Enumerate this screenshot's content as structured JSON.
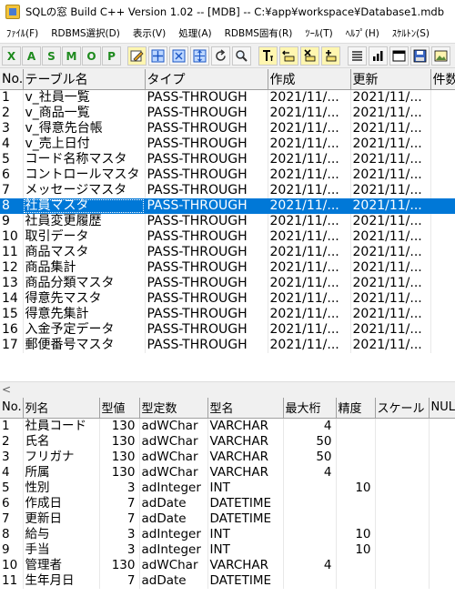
{
  "window": {
    "title": "SQLの窓 Build C++ Version 1.02 -- [MDB] -- C:¥app¥workspace¥Database1.mdb"
  },
  "menu": [
    "ﾌｧｲﾙ(F)",
    "RDBMS選択(D)",
    "表示(V)",
    "処理(A)",
    "RDBMS固有(R)",
    "ﾂｰﾙ(T)",
    "ﾍﾙﾌﾟ(H)",
    "ｽｹﾙﾄﾝ(S)"
  ],
  "toolbar": {
    "letters": [
      "X",
      "A",
      "S",
      "M",
      "O",
      "P"
    ],
    "icons": [
      "edit-icon",
      "expand-icon",
      "collapse-icon",
      "move-icon",
      "refresh-icon",
      "search-icon",
      "text-icon",
      "col-left-icon",
      "col-delete-icon",
      "col-add-icon",
      "list-icon",
      "chart-icon",
      "window-icon",
      "save-icon",
      "image-icon"
    ]
  },
  "tables_grid": {
    "headers": [
      "No.",
      "テーブル名",
      "タイプ",
      "作成",
      "更新",
      "件数"
    ],
    "rows": [
      [
        "1",
        "v_社員一覧",
        "PASS-THROUGH",
        "2021/11/...",
        "2021/11/...",
        ""
      ],
      [
        "2",
        "v_商品一覧",
        "PASS-THROUGH",
        "2021/11/...",
        "2021/11/...",
        ""
      ],
      [
        "3",
        "v_得意先台帳",
        "PASS-THROUGH",
        "2021/11/...",
        "2021/11/...",
        ""
      ],
      [
        "4",
        "v_売上日付",
        "PASS-THROUGH",
        "2021/11/...",
        "2021/11/...",
        ""
      ],
      [
        "5",
        "コード名称マスタ",
        "PASS-THROUGH",
        "2021/11/...",
        "2021/11/...",
        ""
      ],
      [
        "6",
        "コントロールマスタ",
        "PASS-THROUGH",
        "2021/11/...",
        "2021/11/...",
        ""
      ],
      [
        "7",
        "メッセージマスタ",
        "PASS-THROUGH",
        "2021/11/...",
        "2021/11/...",
        ""
      ],
      [
        "8",
        "社員マスタ",
        "PASS-THROUGH",
        "2021/11/...",
        "2021/11/...",
        ""
      ],
      [
        "9",
        "社員変更履歴",
        "PASS-THROUGH",
        "2021/11/...",
        "2021/11/...",
        ""
      ],
      [
        "10",
        "取引データ",
        "PASS-THROUGH",
        "2021/11/...",
        "2021/11/...",
        ""
      ],
      [
        "11",
        "商品マスタ",
        "PASS-THROUGH",
        "2021/11/...",
        "2021/11/...",
        ""
      ],
      [
        "12",
        "商品集計",
        "PASS-THROUGH",
        "2021/11/...",
        "2021/11/...",
        ""
      ],
      [
        "13",
        "商品分類マスタ",
        "PASS-THROUGH",
        "2021/11/...",
        "2021/11/...",
        ""
      ],
      [
        "14",
        "得意先マスタ",
        "PASS-THROUGH",
        "2021/11/...",
        "2021/11/...",
        ""
      ],
      [
        "15",
        "得意先集計",
        "PASS-THROUGH",
        "2021/11/...",
        "2021/11/...",
        ""
      ],
      [
        "16",
        "入金予定データ",
        "PASS-THROUGH",
        "2021/11/...",
        "2021/11/...",
        ""
      ],
      [
        "17",
        "郵便番号マスタ",
        "PASS-THROUGH",
        "2021/11/...",
        "2021/11/...",
        ""
      ]
    ],
    "selected_row": 8
  },
  "scrollbar": {
    "left_arrow": "<"
  },
  "columns_grid": {
    "headers": [
      "No.",
      "列名",
      "型値",
      "型定数",
      "型名",
      "最大桁",
      "精度",
      "スケール",
      "NUL"
    ],
    "rows": [
      [
        "1",
        "社員コード",
        "130",
        "adWChar",
        "VARCHAR",
        "4",
        "",
        "",
        ""
      ],
      [
        "2",
        "氏名",
        "130",
        "adWChar",
        "VARCHAR",
        "50",
        "",
        "",
        ""
      ],
      [
        "3",
        "フリガナ",
        "130",
        "adWChar",
        "VARCHAR",
        "50",
        "",
        "",
        ""
      ],
      [
        "4",
        "所属",
        "130",
        "adWChar",
        "VARCHAR",
        "4",
        "",
        "",
        ""
      ],
      [
        "5",
        "性別",
        "3",
        "adInteger",
        "INT",
        "",
        "10",
        "",
        ""
      ],
      [
        "6",
        "作成日",
        "7",
        "adDate",
        "DATETIME",
        "",
        "",
        "",
        ""
      ],
      [
        "7",
        "更新日",
        "7",
        "adDate",
        "DATETIME",
        "",
        "",
        "",
        ""
      ],
      [
        "8",
        "給与",
        "3",
        "adInteger",
        "INT",
        "",
        "10",
        "",
        ""
      ],
      [
        "9",
        "手当",
        "3",
        "adInteger",
        "INT",
        "",
        "10",
        "",
        ""
      ],
      [
        "10",
        "管理者",
        "130",
        "adWChar",
        "VARCHAR",
        "4",
        "",
        "",
        ""
      ],
      [
        "11",
        "生年月日",
        "7",
        "adDate",
        "DATETIME",
        "",
        "",
        "",
        ""
      ]
    ]
  },
  "colors": {
    "selection": "#0078d7",
    "toolbar_letter": "#1e8a1e",
    "header_bg": "#f0f0f0"
  }
}
